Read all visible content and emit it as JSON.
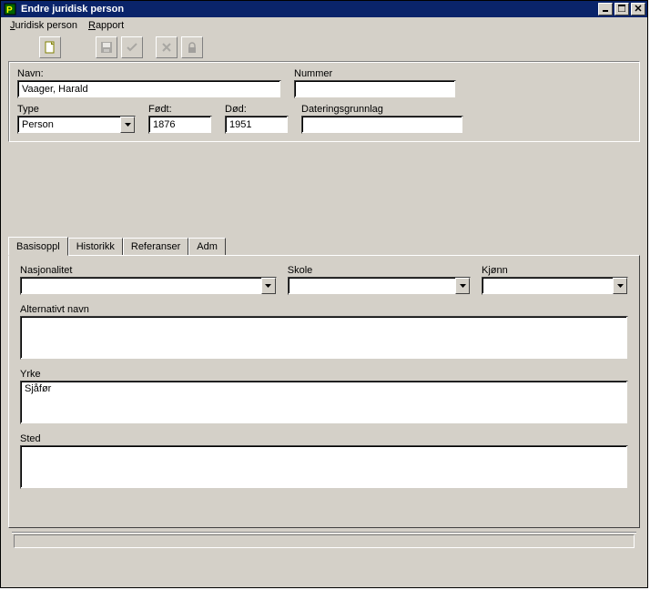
{
  "title": "Endre juridisk person",
  "menu": {
    "juridisk": "Juridisk person",
    "rapport": "Rapport"
  },
  "toolbar": {
    "new": "new-doc",
    "save": "save",
    "check": "check",
    "cancel": "cancel",
    "lock": "lock"
  },
  "form": {
    "navn_label": "Navn:",
    "navn_value": "Vaager, Harald",
    "nummer_label": "Nummer",
    "nummer_value": "",
    "type_label": "Type",
    "type_value": "Person",
    "fodt_label": "Født:",
    "fodt_value": "1876",
    "dod_label": "Død:",
    "dod_value": "1951",
    "dater_label": "Dateringsgrunnlag",
    "dater_value": ""
  },
  "tabs": {
    "basis": "Basisoppl",
    "hist": "Historikk",
    "ref": "Referanser",
    "adm": "Adm"
  },
  "basis": {
    "nasj_label": "Nasjonalitet",
    "nasj_value": "",
    "skole_label": "Skole",
    "skole_value": "",
    "kjonn_label": "Kjønn",
    "kjonn_value": "",
    "altnavn_label": "Alternativt navn",
    "altnavn_value": "",
    "yrke_label": "Yrke",
    "yrke_value": "Sjåfør",
    "sted_label": "Sted",
    "sted_value": ""
  }
}
